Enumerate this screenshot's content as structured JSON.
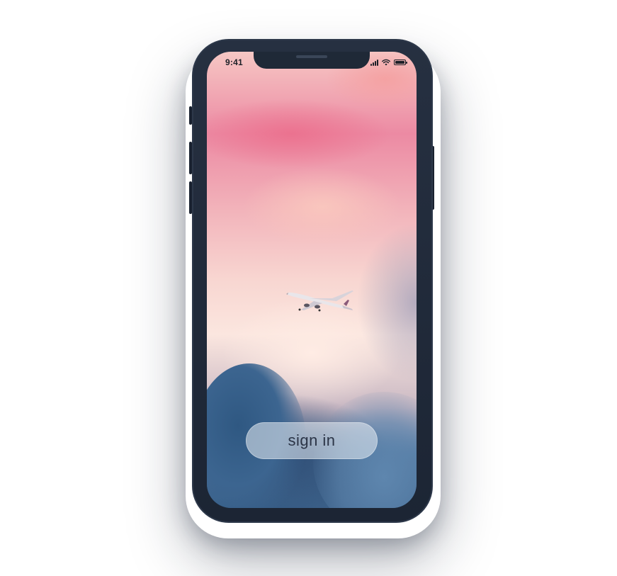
{
  "status_bar": {
    "time": "9:41",
    "signal_icon": "cellular-signal-icon",
    "wifi_icon": "wifi-icon",
    "battery_icon": "battery-icon",
    "battery_level": 1.0
  },
  "background": {
    "description_icon": "airplane-in-sky-photo"
  },
  "actions": {
    "sign_in_label": "sign in"
  },
  "colors": {
    "device_frame": "#1f2937",
    "button_text": "#2b3446",
    "status_text": "#1b1f27"
  }
}
